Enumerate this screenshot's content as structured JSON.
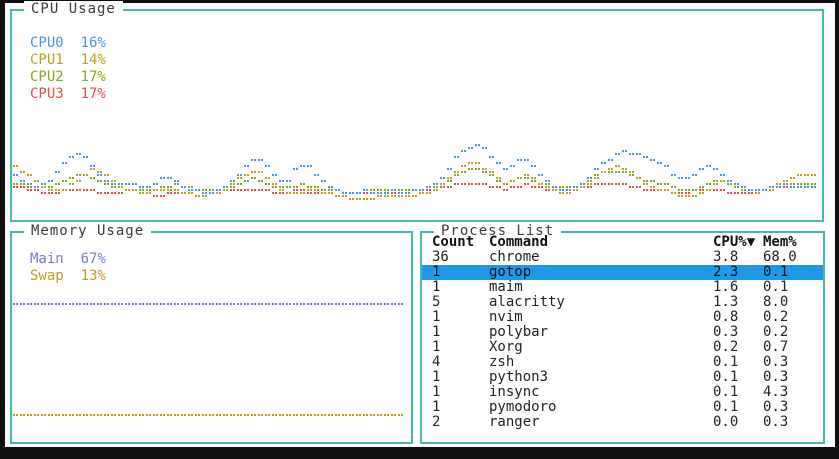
{
  "theme": {
    "border_color": "#45b8b0",
    "title_color": "#3a3a3a",
    "text_color": "#232323",
    "highlight_bg": "#1d99e8",
    "highlight_text": "#06131c",
    "frame_color": "#0f0f0f",
    "screen_bg": "#ffffff"
  },
  "cpu_panel": {
    "title": "CPU Usage",
    "legend": [
      {
        "label": "CPU0",
        "value": "16%",
        "color": "#4a97d9"
      },
      {
        "label": "CPU1",
        "value": "14%",
        "color": "#c0a020"
      },
      {
        "label": "CPU2",
        "value": "17%",
        "color": "#86a81e"
      },
      {
        "label": "CPU3",
        "value": "17%",
        "color": "#de5151"
      }
    ]
  },
  "memory_panel": {
    "title": "Memory Usage",
    "legend": [
      {
        "label": "Main",
        "value": "67%",
        "color": "#7b7bc8"
      },
      {
        "label": "Swap",
        "value": "13%",
        "color": "#c89a20"
      }
    ]
  },
  "process_panel": {
    "title": "Process List",
    "columns": [
      "Count",
      "Command",
      "CPU%▼",
      "Mem%"
    ],
    "rows": [
      {
        "count": "36",
        "command": "chrome",
        "cpu": "3.8",
        "mem": "68.0",
        "selected": false
      },
      {
        "count": "1",
        "command": "gotop",
        "cpu": "2.3",
        "mem": "0.1",
        "selected": true
      },
      {
        "count": "1",
        "command": "maim",
        "cpu": "1.6",
        "mem": "0.1",
        "selected": false
      },
      {
        "count": "5",
        "command": "alacritty",
        "cpu": "1.3",
        "mem": "8.0",
        "selected": false
      },
      {
        "count": "1",
        "command": "nvim",
        "cpu": "0.8",
        "mem": "0.2",
        "selected": false
      },
      {
        "count": "1",
        "command": "polybar",
        "cpu": "0.3",
        "mem": "0.2",
        "selected": false
      },
      {
        "count": "1",
        "command": "Xorg",
        "cpu": "0.2",
        "mem": "0.7",
        "selected": false
      },
      {
        "count": "4",
        "command": "zsh",
        "cpu": "0.1",
        "mem": "0.3",
        "selected": false
      },
      {
        "count": "1",
        "command": "python3",
        "cpu": "0.1",
        "mem": "0.3",
        "selected": false
      },
      {
        "count": "1",
        "command": "insync",
        "cpu": "0.1",
        "mem": "4.3",
        "selected": false
      },
      {
        "count": "1",
        "command": "pymodoro",
        "cpu": "0.1",
        "mem": "0.3",
        "selected": false
      },
      {
        "count": "2",
        "command": "ranger",
        "cpu": "0.0",
        "mem": "0.3",
        "selected": false
      }
    ]
  },
  "chart_data": [
    {
      "type": "line",
      "title": "CPU Usage",
      "style": "braille-dots",
      "ylim": [
        0,
        100
      ],
      "legend_position": "top-left",
      "grid": false,
      "series": [
        {
          "name": "CPU0",
          "current": 16,
          "color": "#4a97d9",
          "values": [
            22,
            18,
            16,
            17,
            22,
            28,
            33,
            30,
            24,
            19,
            17,
            18,
            17,
            16,
            18,
            21,
            19,
            16,
            14,
            13,
            14,
            16,
            20,
            26,
            30,
            27,
            21,
            17,
            24,
            27,
            23,
            17,
            14,
            13,
            13,
            14,
            13,
            13,
            14,
            13,
            14,
            15,
            17,
            22,
            30,
            35,
            36,
            34,
            29,
            24,
            28,
            30,
            25,
            19,
            16,
            14,
            16,
            19,
            24,
            28,
            31,
            33,
            32,
            30,
            29,
            26,
            21,
            19,
            22,
            26,
            24,
            20,
            17,
            15,
            14,
            15,
            16,
            17,
            16,
            16,
            16
          ]
        },
        {
          "name": "CPU1",
          "current": 14,
          "color": "#c0a020",
          "values": [
            26,
            23,
            19,
            15,
            14,
            15,
            18,
            22,
            25,
            22,
            18,
            15,
            14,
            13,
            14,
            15,
            14,
            13,
            12,
            12,
            13,
            15,
            18,
            22,
            24,
            21,
            17,
            14,
            13,
            14,
            15,
            13,
            12,
            11,
            10,
            10,
            11,
            12,
            12,
            11,
            12,
            13,
            15,
            18,
            23,
            27,
            28,
            25,
            21,
            18,
            20,
            22,
            19,
            16,
            14,
            13,
            14,
            16,
            20,
            24,
            26,
            25,
            22,
            18,
            16,
            14,
            12,
            11,
            12,
            14,
            17,
            19,
            17,
            15,
            13,
            14,
            16,
            19,
            21,
            22,
            21
          ]
        },
        {
          "name": "CPU2",
          "current": 17,
          "color": "#86a81e",
          "values": [
            18,
            17,
            16,
            16,
            17,
            19,
            21,
            22,
            20,
            18,
            16,
            15,
            14,
            14,
            15,
            16,
            17,
            16,
            15,
            14,
            14,
            15,
            17,
            19,
            20,
            18,
            16,
            15,
            16,
            17,
            16,
            15,
            14,
            13,
            13,
            14,
            14,
            15,
            15,
            14,
            14,
            15,
            16,
            18,
            21,
            24,
            25,
            23,
            20,
            18,
            19,
            21,
            19,
            17,
            16,
            15,
            16,
            18,
            21,
            23,
            24,
            23,
            21,
            19,
            18,
            17,
            15,
            14,
            15,
            17,
            19,
            18,
            16,
            15,
            14,
            15,
            16,
            17,
            18,
            17,
            17
          ]
        },
        {
          "name": "CPU3",
          "current": 17,
          "color": "#de5151",
          "values": [
            16,
            15,
            14,
            13,
            13,
            14,
            15,
            15,
            14,
            13,
            13,
            14,
            14,
            13,
            12,
            12,
            13,
            13,
            12,
            12,
            13,
            14,
            14,
            15,
            15,
            14,
            13,
            13,
            14,
            14,
            13,
            13,
            12,
            12,
            13,
            13,
            14,
            14,
            13,
            13,
            14,
            14,
            15,
            16,
            17,
            18,
            18,
            17,
            16,
            15,
            16,
            17,
            16,
            15,
            14,
            14,
            15,
            16,
            17,
            18,
            18,
            17,
            16,
            15,
            15,
            14,
            13,
            13,
            14,
            15,
            15,
            14,
            13,
            13,
            14,
            15,
            15,
            16,
            16,
            17,
            17
          ]
        }
      ]
    },
    {
      "type": "line",
      "title": "Memory Usage",
      "style": "braille-dots",
      "ylim": [
        0,
        100
      ],
      "legend_position": "top-left",
      "grid": false,
      "series": [
        {
          "name": "Main",
          "current": 67,
          "color": "#7b7bc8",
          "values": [
            67,
            67
          ]
        },
        {
          "name": "Swap",
          "current": 13,
          "color": "#c89a20",
          "values": [
            13,
            13
          ]
        }
      ]
    }
  ]
}
